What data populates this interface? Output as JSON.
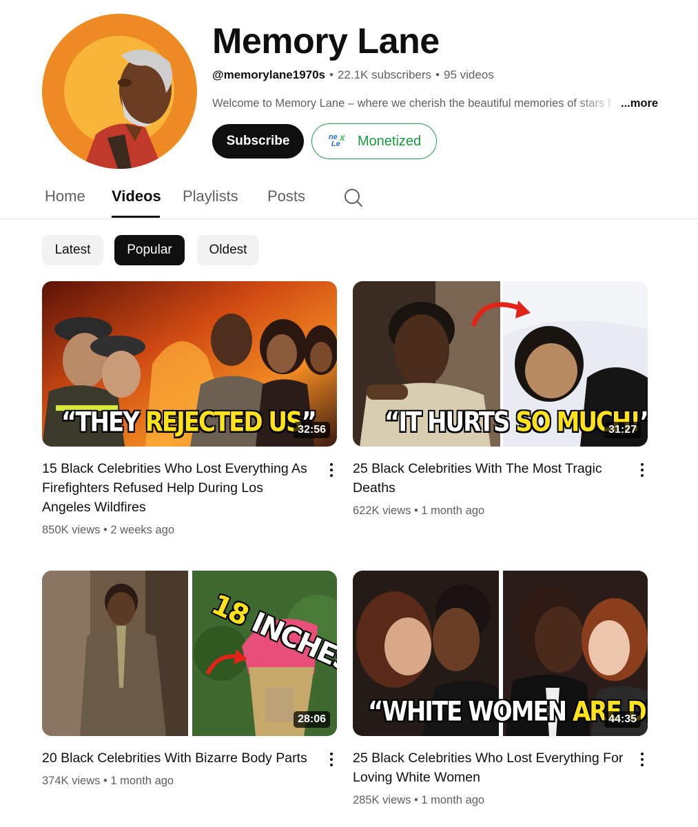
{
  "channel": {
    "name": "Memory Lane",
    "handle": "@memorylane1970s",
    "subscribers": "22.1K subscribers",
    "video_count": "95 videos",
    "separator": "•",
    "description": "Welcome to Memory Lane – where we cherish the beautiful memories of stars f",
    "more_label": "...more",
    "subscribe_label": "Subscribe",
    "monetized_label": "Monetized",
    "monetized_logo": "nexlev-logo"
  },
  "tabs": [
    {
      "label": "Home"
    },
    {
      "label": "Videos",
      "active": true
    },
    {
      "label": "Playlists"
    },
    {
      "label": "Posts"
    }
  ],
  "search_icon": "search-icon",
  "filters": [
    {
      "label": "Latest"
    },
    {
      "label": "Popular",
      "active": true
    },
    {
      "label": "Oldest"
    }
  ],
  "videos": [
    {
      "title": "15 Black Celebrities Who Lost Everything As Firefighters Refused Help During Los Angeles Wildfires",
      "views": "850K views",
      "age": "2 weeks ago",
      "duration": "32:56",
      "overlay_white": "“THEY ",
      "overlay_yellow": "REJECTED US",
      "overlay_end": "”"
    },
    {
      "title": "25 Black Celebrities With The Most Tragic Deaths",
      "views": "622K views",
      "age": "1 month ago",
      "duration": "31:27",
      "overlay_white": "“IT HURTS ",
      "overlay_yellow": "SO MUCH!",
      "overlay_end": "”"
    },
    {
      "title": "20 Black Celebrities With Bizarre Body Parts",
      "views": "374K views",
      "age": "1 month ago",
      "duration": "28:06",
      "overlay_yellow": "18 ",
      "overlay_white": "INCHES"
    },
    {
      "title": "25 Black Celebrities Who Lost Everything For Loving White Women",
      "views": "285K views",
      "age": "1 month ago",
      "duration": "44:35",
      "overlay_white": "“WHITE WOMEN ",
      "overlay_yellow": "ARE DELICIOUS",
      "overlay_end": "”"
    }
  ],
  "colors": {
    "text": "#0f0f0f",
    "secondary_text": "#606060",
    "monetized_green": "#1b9a3f",
    "overlay_yellow": "#ffe21a"
  }
}
